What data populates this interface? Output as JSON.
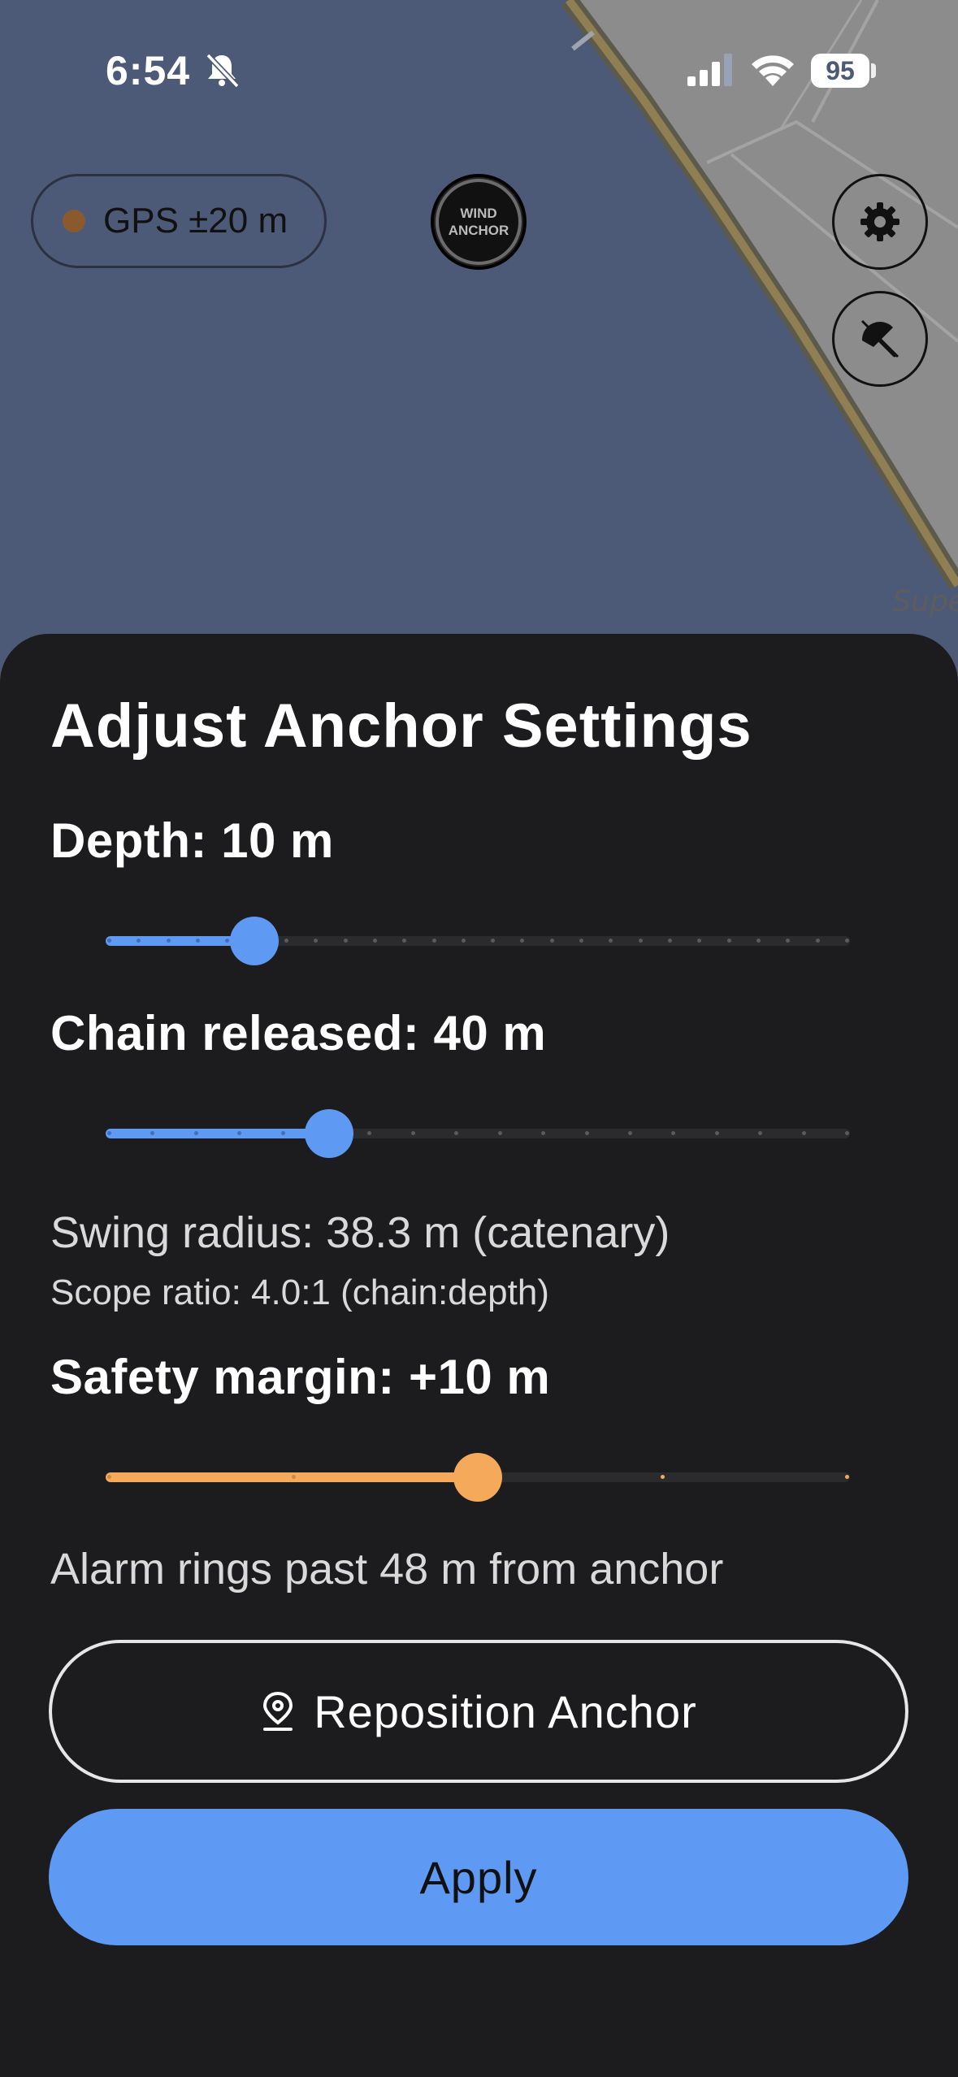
{
  "status_bar": {
    "time": "6:54",
    "battery": "95",
    "icons": [
      "bell-slash-icon",
      "cellular-signal-icon",
      "wifi-icon",
      "battery-icon"
    ]
  },
  "map": {
    "partial_label": "Supe",
    "gps_status": "GPS ±20 m",
    "wind_anchor": {
      "line1": "WIND",
      "line2": "ANCHOR"
    },
    "buttons": [
      "gear-icon",
      "umbrella-icon"
    ]
  },
  "sheet": {
    "title": "Adjust Anchor Settings",
    "depth": {
      "label": "Depth: 10 m",
      "value": 10,
      "min": 0,
      "max": 50,
      "fraction": 0.2
    },
    "chain": {
      "label": "Chain released: 40 m",
      "value": 40,
      "fraction": 0.3
    },
    "swing_radius": "Swing radius: 38.3 m (catenary)",
    "scope_ratio": "Scope ratio: 4.0:1 (chain:depth)",
    "safety": {
      "label": "Safety margin: +10 m",
      "value": 10,
      "fraction": 0.5
    },
    "alarm_text": "Alarm rings past 48 m from anchor",
    "reposition_button": "Reposition Anchor",
    "apply_button": "Apply"
  },
  "colors": {
    "accent_blue": "#5e9af3",
    "accent_orange": "#f5a95a",
    "sheet_bg": "#1c1c1e",
    "water": "#4d5a77",
    "land": "#8c8c8c"
  }
}
